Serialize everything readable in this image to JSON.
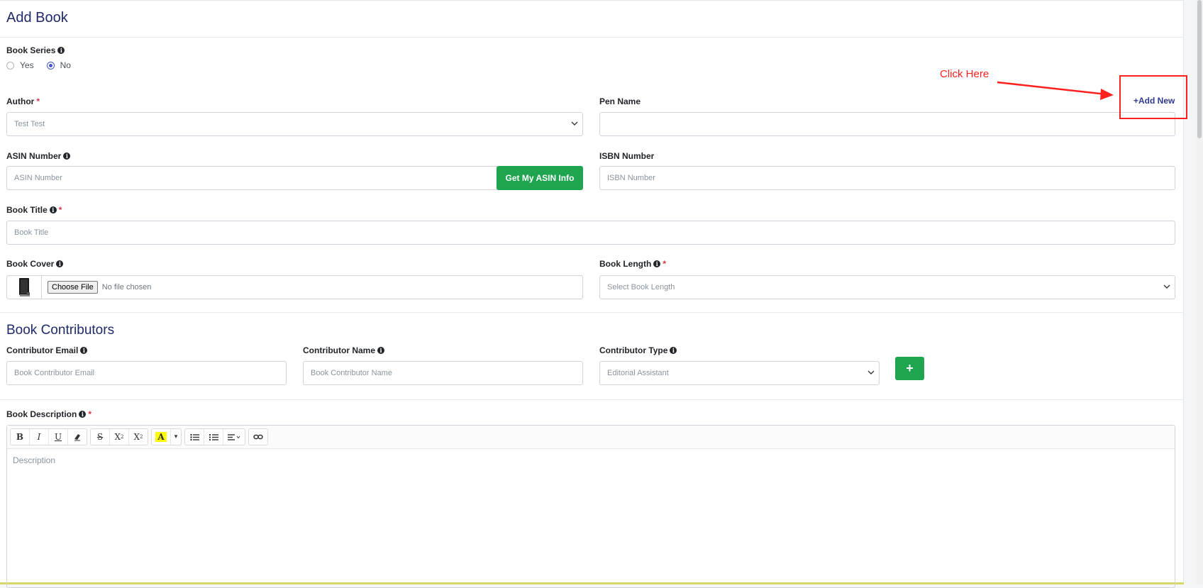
{
  "page": {
    "title": "Add Book"
  },
  "book_series": {
    "label": "Book Series",
    "options": [
      {
        "label": "Yes",
        "checked": false
      },
      {
        "label": "No",
        "checked": true
      }
    ]
  },
  "author": {
    "label": "Author",
    "value": "Test Test"
  },
  "pen_name": {
    "label": "Pen Name",
    "value": "",
    "add_new_label": "Add New"
  },
  "asin": {
    "label": "ASIN Number",
    "placeholder": "ASIN Number",
    "button_label": "Get My ASIN Info"
  },
  "isbn": {
    "label": "ISBN Number",
    "placeholder": "ISBN Number"
  },
  "book_title": {
    "label": "Book Title",
    "placeholder": "Book Title"
  },
  "book_cover": {
    "label": "Book Cover",
    "choose_label": "Choose File",
    "status": "No file chosen"
  },
  "book_length": {
    "label": "Book Length",
    "placeholder": "Select Book Length"
  },
  "contributors": {
    "title": "Book Contributors",
    "email_label": "Contributor Email",
    "email_placeholder": "Book Contributor Email",
    "name_label": "Contributor Name",
    "name_placeholder": "Book Contributor Name",
    "type_label": "Contributor Type",
    "type_value": "Editorial Assistant",
    "add_label": "+"
  },
  "description": {
    "label": "Book Description",
    "placeholder": "Description",
    "toolbar": {
      "bold": "B",
      "italic": "I",
      "underline": "U",
      "strike": "S",
      "superscript": "X",
      "subscript": "X",
      "highlight": "A"
    }
  },
  "annotation": {
    "text": "Click Here"
  },
  "colors": {
    "accent": "#1f2a6b",
    "green": "#1fa54f",
    "required": "#dc3545",
    "annotation": "#ff2020"
  }
}
